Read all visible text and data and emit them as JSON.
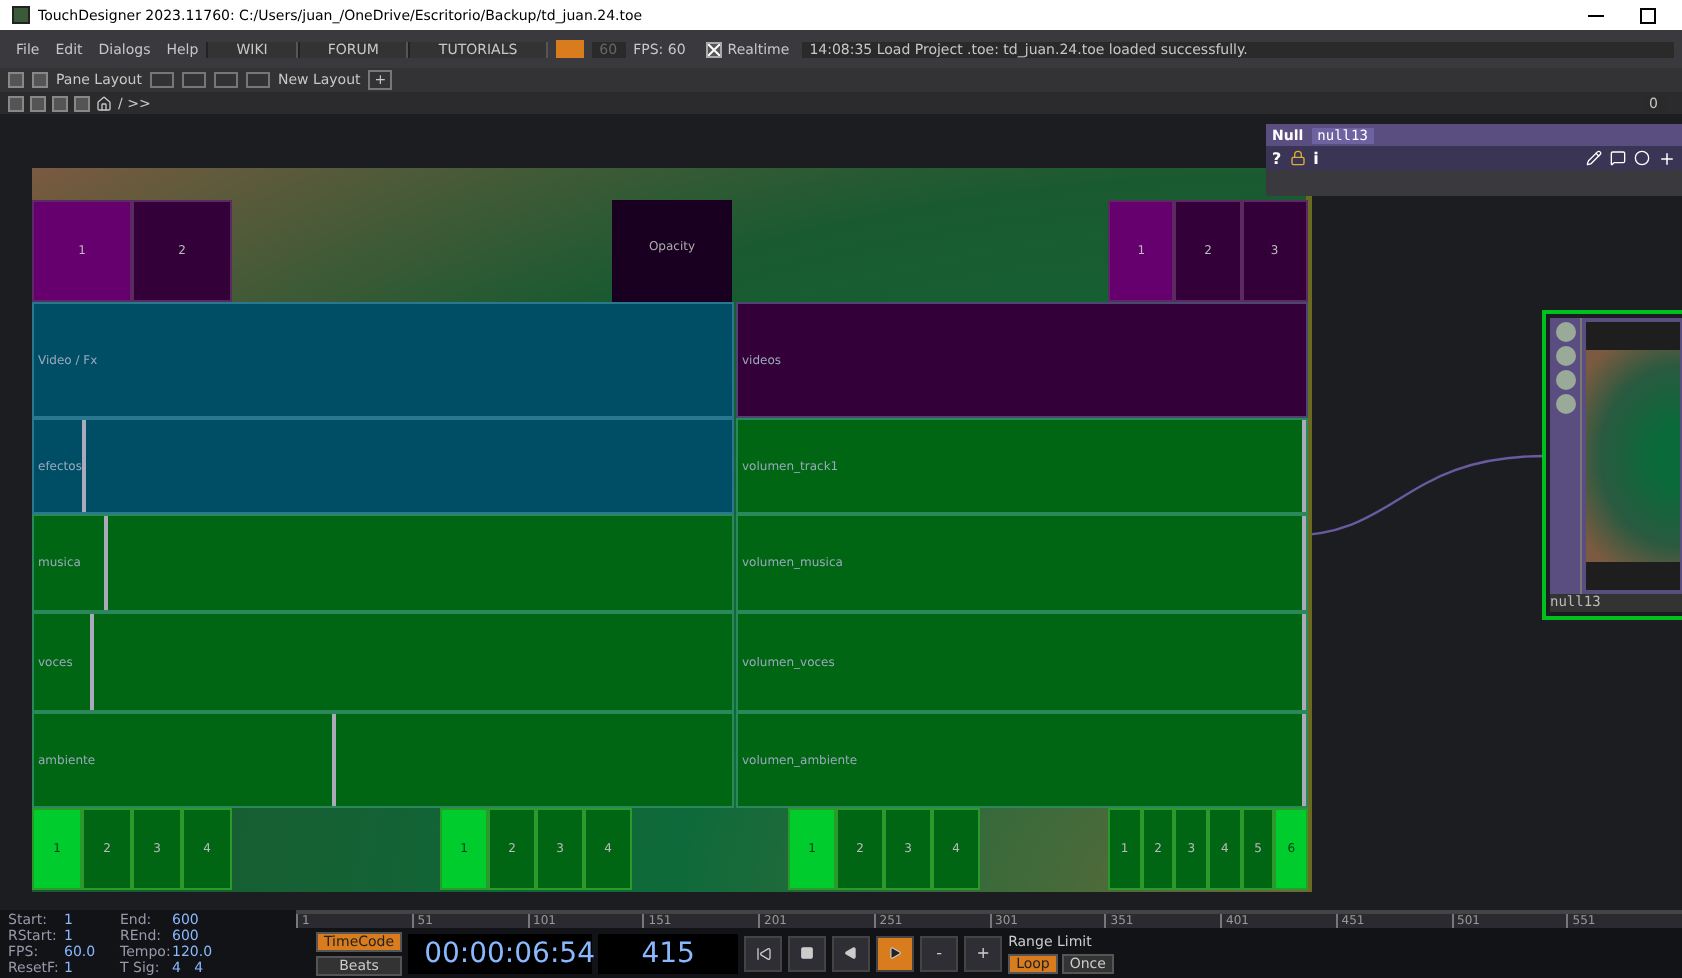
{
  "window": {
    "title": "TouchDesigner 2023.11760: C:/Users/juan_/OneDrive/Escritorio/Backup/td_juan.24.toe"
  },
  "menu": [
    "File",
    "Edit",
    "Dialogs",
    "Help"
  ],
  "links": [
    "WIKI",
    "FORUM",
    "TUTORIALS"
  ],
  "fps_field": "60",
  "fps_label": "FPS: 60",
  "realtime": {
    "label": "Realtime",
    "checked": true
  },
  "message": "14:08:35 Load Project .toe: td_juan.24.toe loaded successfully.",
  "toolbar": {
    "pane_layout": "Pane Layout",
    "new_layout": "New Layout",
    "add": "+"
  },
  "path": {
    "text": "/ >>",
    "counter": "0"
  },
  "panel": {
    "top_left_buttons": [
      {
        "label": "1",
        "selected": true
      },
      {
        "label": "2",
        "selected": false
      }
    ],
    "opacity_label": "Opacity",
    "top_right_buttons": [
      {
        "label": "1",
        "selected": true
      },
      {
        "label": "2",
        "selected": false
      },
      {
        "label": "3",
        "selected": false
      }
    ],
    "left_column": [
      {
        "kind": "header",
        "label": "Video / Fx",
        "color": "#004d66"
      },
      {
        "kind": "slider",
        "label": "efectos",
        "color": "#004d66",
        "level": 0.07
      },
      {
        "kind": "slider",
        "label": "musica",
        "color": "#006614",
        "level": 0.1
      },
      {
        "kind": "slider",
        "label": "voces",
        "color": "#006614",
        "level": 0.08
      },
      {
        "kind": "slider",
        "label": "ambiente",
        "color": "#006614",
        "level": 0.43
      }
    ],
    "right_column": [
      {
        "kind": "header",
        "label": "videos",
        "color": "#33003a"
      },
      {
        "kind": "slider",
        "label": "volumen_track1",
        "color": "#006614",
        "level": 1
      },
      {
        "kind": "slider",
        "label": "volumen_musica",
        "color": "#006614",
        "level": 1
      },
      {
        "kind": "slider",
        "label": "volumen_voces",
        "color": "#006614",
        "level": 1
      },
      {
        "kind": "slider",
        "label": "volumen_ambiente",
        "color": "#006614",
        "level": 1
      }
    ],
    "button_groups": [
      {
        "buttons": [
          {
            "label": "1",
            "selected": true
          },
          {
            "label": "2",
            "selected": false
          },
          {
            "label": "3",
            "selected": false
          },
          {
            "label": "4",
            "selected": false
          }
        ]
      },
      {
        "buttons": [
          {
            "label": "1",
            "selected": true
          },
          {
            "label": "2",
            "selected": false
          },
          {
            "label": "3",
            "selected": false
          },
          {
            "label": "4",
            "selected": false
          }
        ]
      },
      {
        "buttons": [
          {
            "label": "1",
            "selected": true
          },
          {
            "label": "2",
            "selected": false
          },
          {
            "label": "3",
            "selected": false
          },
          {
            "label": "4",
            "selected": false
          }
        ]
      },
      {
        "buttons": [
          {
            "label": "1",
            "selected": false
          },
          {
            "label": "2",
            "selected": false
          },
          {
            "label": "3",
            "selected": false
          },
          {
            "label": "4",
            "selected": false
          },
          {
            "label": "5",
            "selected": false
          },
          {
            "label": "6",
            "selected": true
          }
        ]
      }
    ]
  },
  "parameters": {
    "type": "Null",
    "name": "null13",
    "help": "?",
    "info": "i"
  },
  "node": {
    "name": "null13"
  },
  "timeline": {
    "info": [
      {
        "label": "Start:",
        "value": "1"
      },
      {
        "label": "End:",
        "value": "600"
      },
      {
        "label": "RStart:",
        "value": "1"
      },
      {
        "label": "REnd:",
        "value": "600"
      },
      {
        "label": "FPS:",
        "value": "60.0"
      },
      {
        "label": "Tempo:",
        "value": "120.0"
      },
      {
        "label": "ResetF:",
        "value": "1"
      },
      {
        "label": "T Sig:",
        "value": "4   4"
      }
    ],
    "ruler": [
      "1",
      "51",
      "101",
      "151",
      "201",
      "251",
      "301",
      "351",
      "401",
      "451",
      "501",
      "551"
    ],
    "time_modes": [
      {
        "label": "TimeCode",
        "selected": true
      },
      {
        "label": "Beats",
        "selected": false
      }
    ],
    "timecode": "00:00:06:54",
    "frame": "415",
    "transport": [
      {
        "kind": "rewind",
        "selected": false
      },
      {
        "kind": "stop",
        "selected": false
      },
      {
        "kind": "reverse",
        "selected": false
      },
      {
        "kind": "play",
        "selected": true
      }
    ],
    "steps": [
      "-",
      "+"
    ],
    "range_label": "Range Limit",
    "range_modes": [
      {
        "label": "Loop",
        "selected": true
      },
      {
        "label": "Once",
        "selected": false
      }
    ]
  }
}
